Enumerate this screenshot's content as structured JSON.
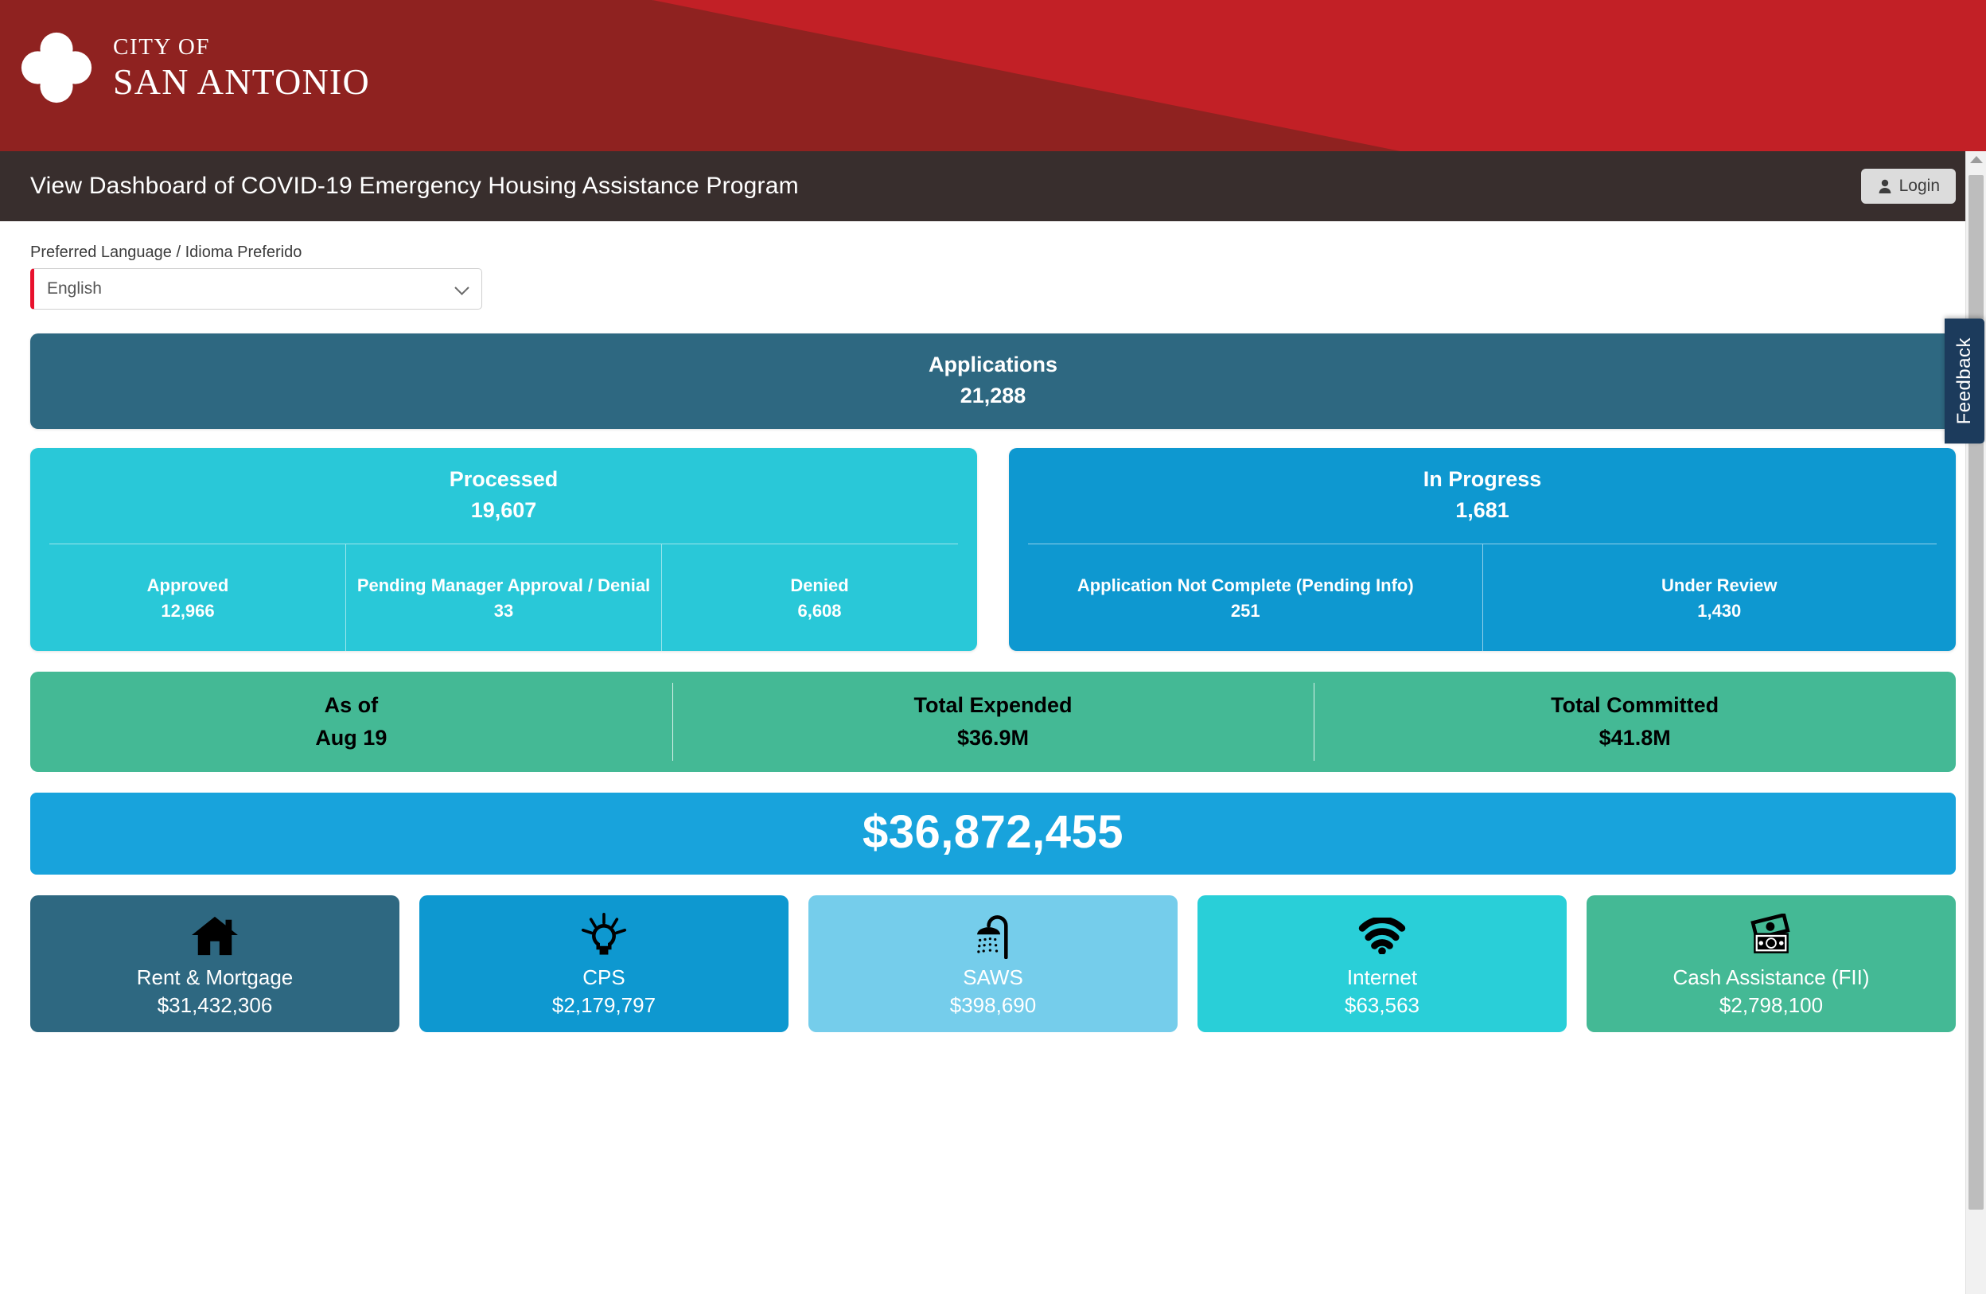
{
  "brand": {
    "line1": "CITY OF",
    "line2": "SAN ANTONIO",
    "banner_dark": "#8f2220",
    "banner_bright": "#c22026"
  },
  "titlebar": {
    "title": "View Dashboard of COVID-19 Emergency Housing Assistance Program",
    "login_label": "Login",
    "background": "#382e2d"
  },
  "language": {
    "label": "Preferred Language / Idioma Preferido",
    "selected": "English",
    "accent": "#e8112d"
  },
  "applications": {
    "title": "Applications",
    "value": "21,288",
    "color": "#2e6881"
  },
  "processed": {
    "title": "Processed",
    "value": "19,607",
    "color": "#29c8d8",
    "subitems": [
      {
        "label": "Approved",
        "value": "12,966"
      },
      {
        "label": "Pending Manager Approval / Denial",
        "value": "33"
      },
      {
        "label": "Denied",
        "value": "6,608"
      }
    ]
  },
  "in_progress": {
    "title": "In Progress",
    "value": "1,681",
    "color": "#0e98d0",
    "subitems": [
      {
        "label": "Application Not Complete (Pending Info)",
        "value": "251"
      },
      {
        "label": "Under Review",
        "value": "1,430"
      }
    ]
  },
  "summary": {
    "color": "#44b995",
    "cells": [
      {
        "label": "As of",
        "value": "Aug 19"
      },
      {
        "label": "Total Expended",
        "value": "$36.9M"
      },
      {
        "label": "Total Committed",
        "value": "$41.8M"
      }
    ]
  },
  "total_bar": {
    "amount": "$36,872,455",
    "color": "#18a3dc"
  },
  "categories": [
    {
      "icon": "house-icon",
      "label": "Rent & Mortgage",
      "amount": "$31,432,306",
      "color": "#2e6881"
    },
    {
      "icon": "lightbulb-icon",
      "label": "CPS",
      "amount": "$2,179,797",
      "color": "#0e98d0"
    },
    {
      "icon": "shower-icon",
      "label": "SAWS",
      "amount": "$398,690",
      "color": "#75cdeb"
    },
    {
      "icon": "wifi-icon",
      "label": "Internet",
      "amount": "$63,563",
      "color": "#29cfd8"
    },
    {
      "icon": "money-icon",
      "label": "Cash Assistance (FII)",
      "amount": "$2,798,100",
      "color": "#44b995"
    }
  ],
  "feedback": {
    "label": "Feedback",
    "color": "#1c3b5c"
  }
}
